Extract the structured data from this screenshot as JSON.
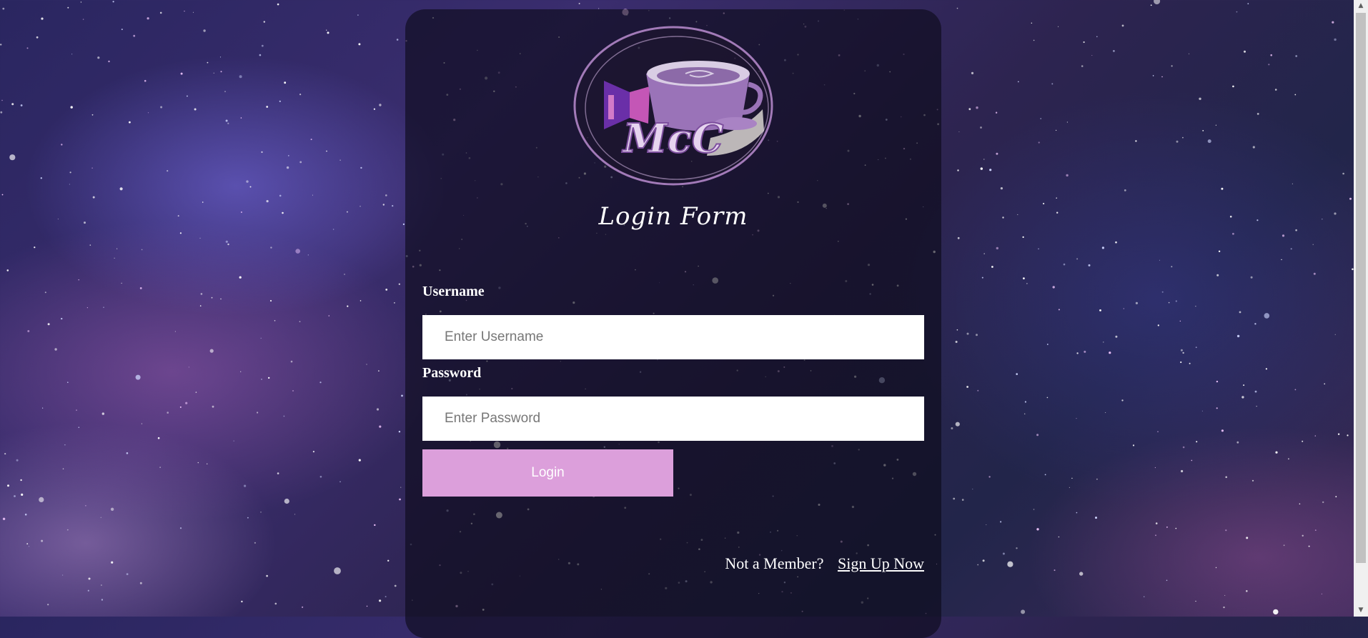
{
  "form": {
    "title": "Login Form",
    "username_label": "Username",
    "username_placeholder": "Enter Username",
    "username_value": "",
    "password_label": "Password",
    "password_placeholder": "Enter Password",
    "password_value": "",
    "login_label": "Login",
    "member_prompt": "Not a Member?",
    "signup_link": "Sign Up Now"
  },
  "logo": {
    "text": "McC",
    "icon": "coffee-cup-logo"
  },
  "colors": {
    "accent": "#dc9fdb",
    "panel": "#0c0a18",
    "text": "#ffffff"
  }
}
